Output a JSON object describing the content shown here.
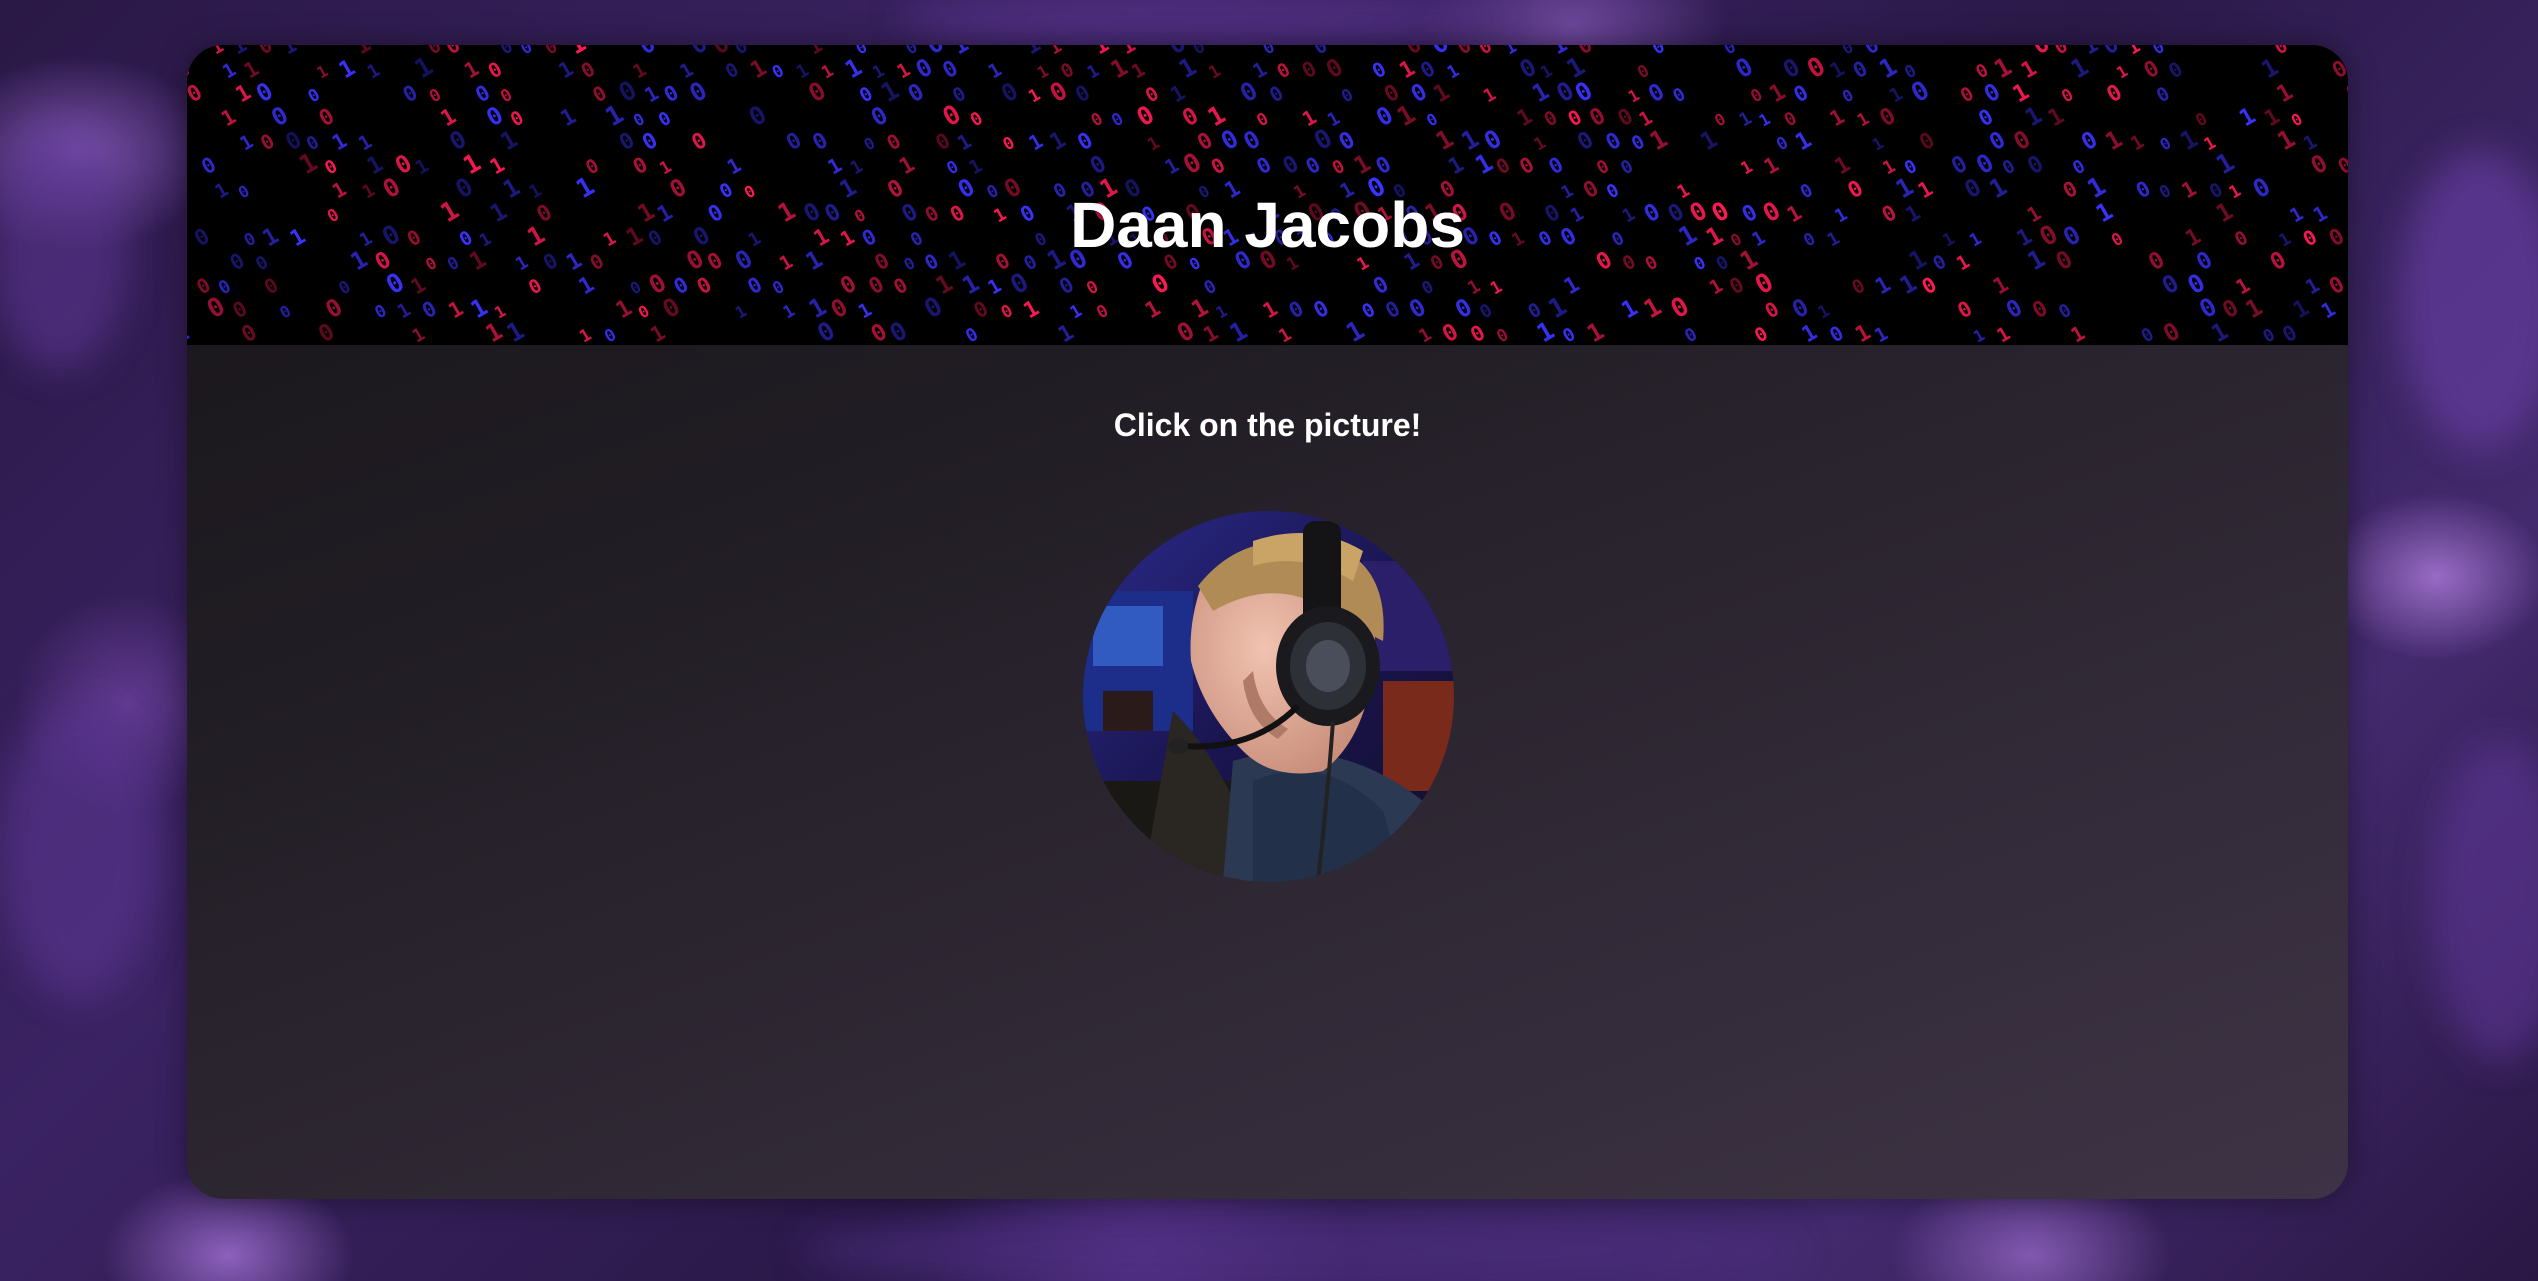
{
  "header": {
    "title": "Daan Jacobs"
  },
  "main": {
    "instruction": "Click on the picture!"
  },
  "profile_picture": {
    "alt": "Daan Jacobs"
  },
  "colors": {
    "background_purple": "#3b2363",
    "card_dark": "#161418",
    "card_light": "#3e3346",
    "binary_red": "#ff1a55",
    "binary_blue": "#3b33ff",
    "text": "#ffffff"
  }
}
